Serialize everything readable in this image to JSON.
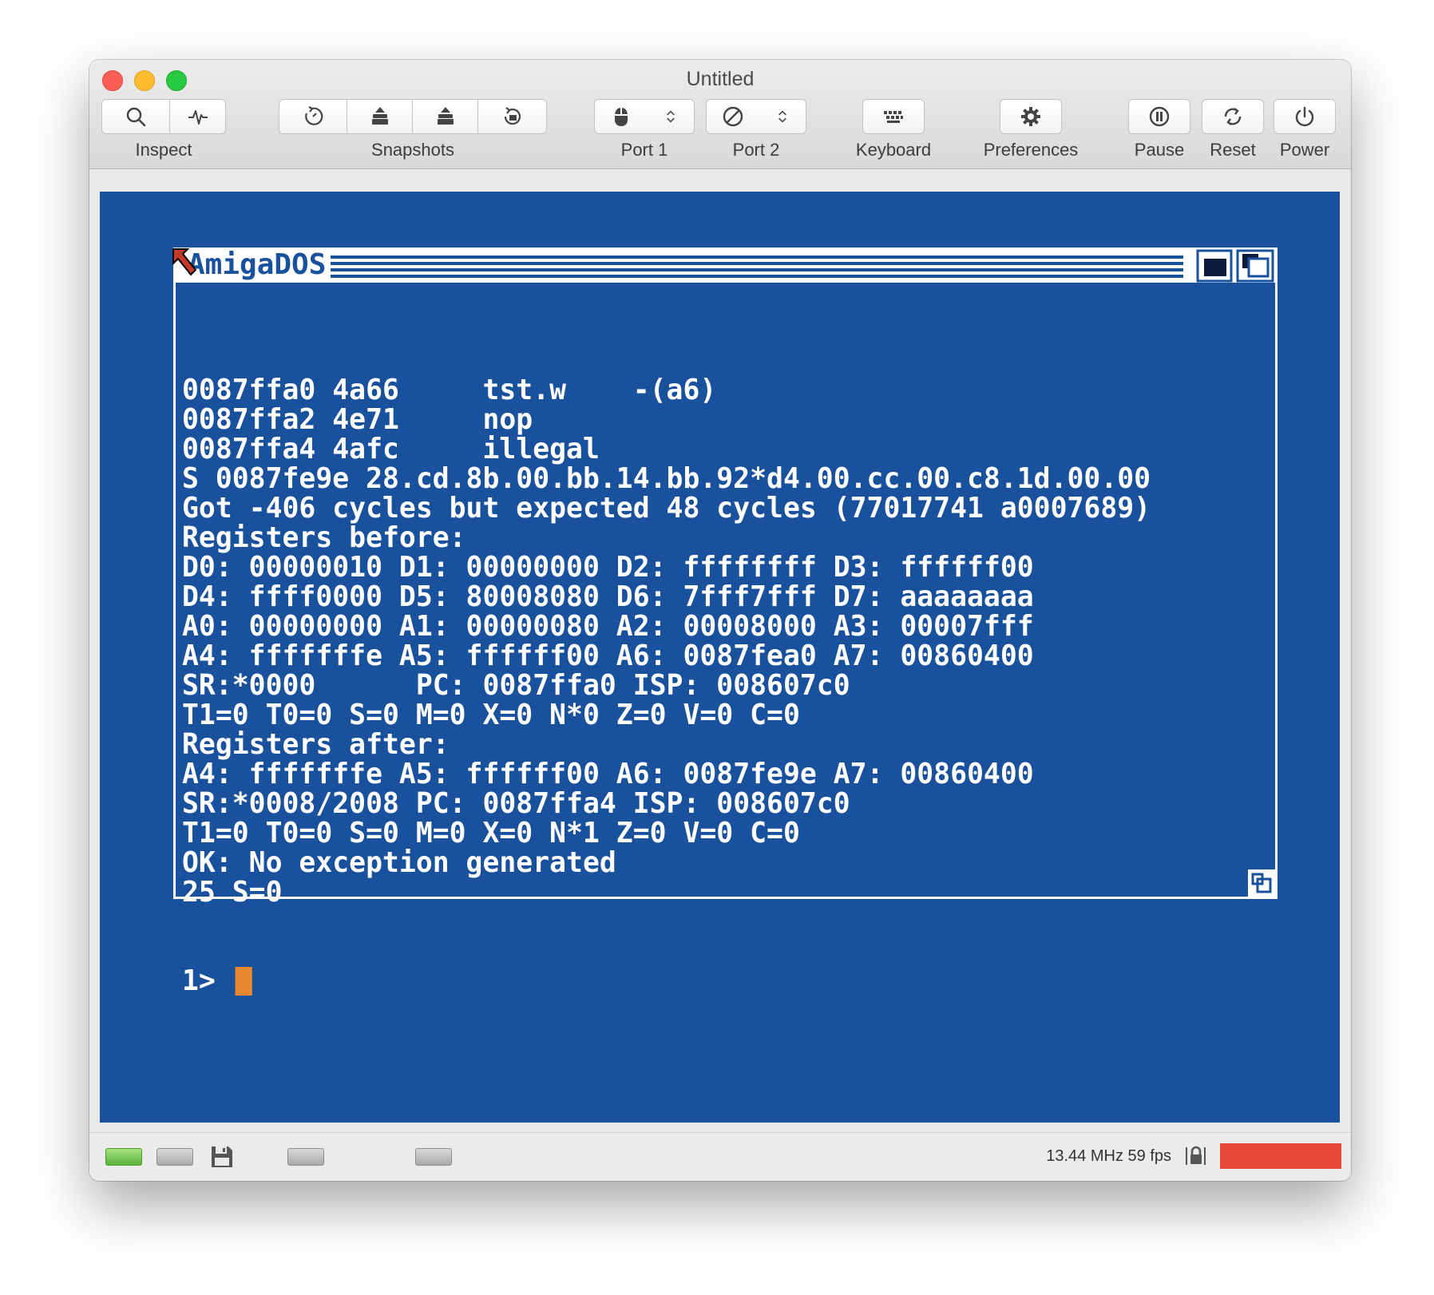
{
  "window": {
    "title": "Untitled"
  },
  "toolbar": {
    "inspect_label": "Inspect",
    "snapshots_label": "Snapshots",
    "port1_label": "Port 1",
    "port2_label": "Port 2",
    "keyboard_label": "Keyboard",
    "preferences_label": "Preferences",
    "pause_label": "Pause",
    "reset_label": "Reset",
    "power_label": "Power"
  },
  "amigados": {
    "title": "AmigaDOS",
    "lines": [
      "0087ffa0 4a66     tst.w    -(a6)",
      "0087ffa2 4e71     nop",
      "0087ffa4 4afc     illegal",
      "S 0087fe9e 28.cd.8b.00.bb.14.bb.92*d4.00.cc.00.c8.1d.00.00",
      "Got -406 cycles but expected 48 cycles (77017741 a0007689)",
      "Registers before:",
      "D0: 00000010 D1: 00000000 D2: ffffffff D3: ffffff00",
      "D4: ffff0000 D5: 80008080 D6: 7fff7fff D7: aaaaaaaa",
      "A0: 00000000 A1: 00000080 A2: 00008000 A3: 00007fff",
      "A4: fffffffe A5: ffffff00 A6: 0087fea0 A7: 00860400",
      "SR:*0000      PC: 0087ffa0 ISP: 008607c0",
      "T1=0 T0=0 S=0 M=0 X=0 N*0 Z=0 V=0 C=0",
      "Registers after:",
      "A4: fffffffe A5: ffffff00 A6: 0087fe9e A7: 00860400",
      "SR:*0008/2008 PC: 0087ffa4 ISP: 008607c0",
      "T1=0 T0=0 S=0 M=0 X=0 N*1 Z=0 V=0 C=0",
      "OK: No exception generated",
      "25 S=0"
    ],
    "prompt": "1> "
  },
  "status": {
    "speed": "13.44 MHz 59 fps"
  },
  "colors": {
    "amiga_blue": "#1a519c",
    "cursor_orange": "#e8892f",
    "warp_red": "#e74a3b",
    "drive_green": "#5cb33d"
  },
  "icons": {
    "inspect": [
      "magnifier-icon",
      "activity-icon"
    ],
    "snapshots": [
      "snapshot-restore-icon",
      "snapshot-stack-icon",
      "snapshot-push-icon",
      "snapshot-rewind-icon"
    ],
    "port1": "mouse-icon",
    "port2": "no-device-icon",
    "keyboard": "keyboard-icon",
    "preferences": "gear-icon",
    "pause": "pause-icon",
    "reset": "reset-icon",
    "power": "power-icon"
  }
}
